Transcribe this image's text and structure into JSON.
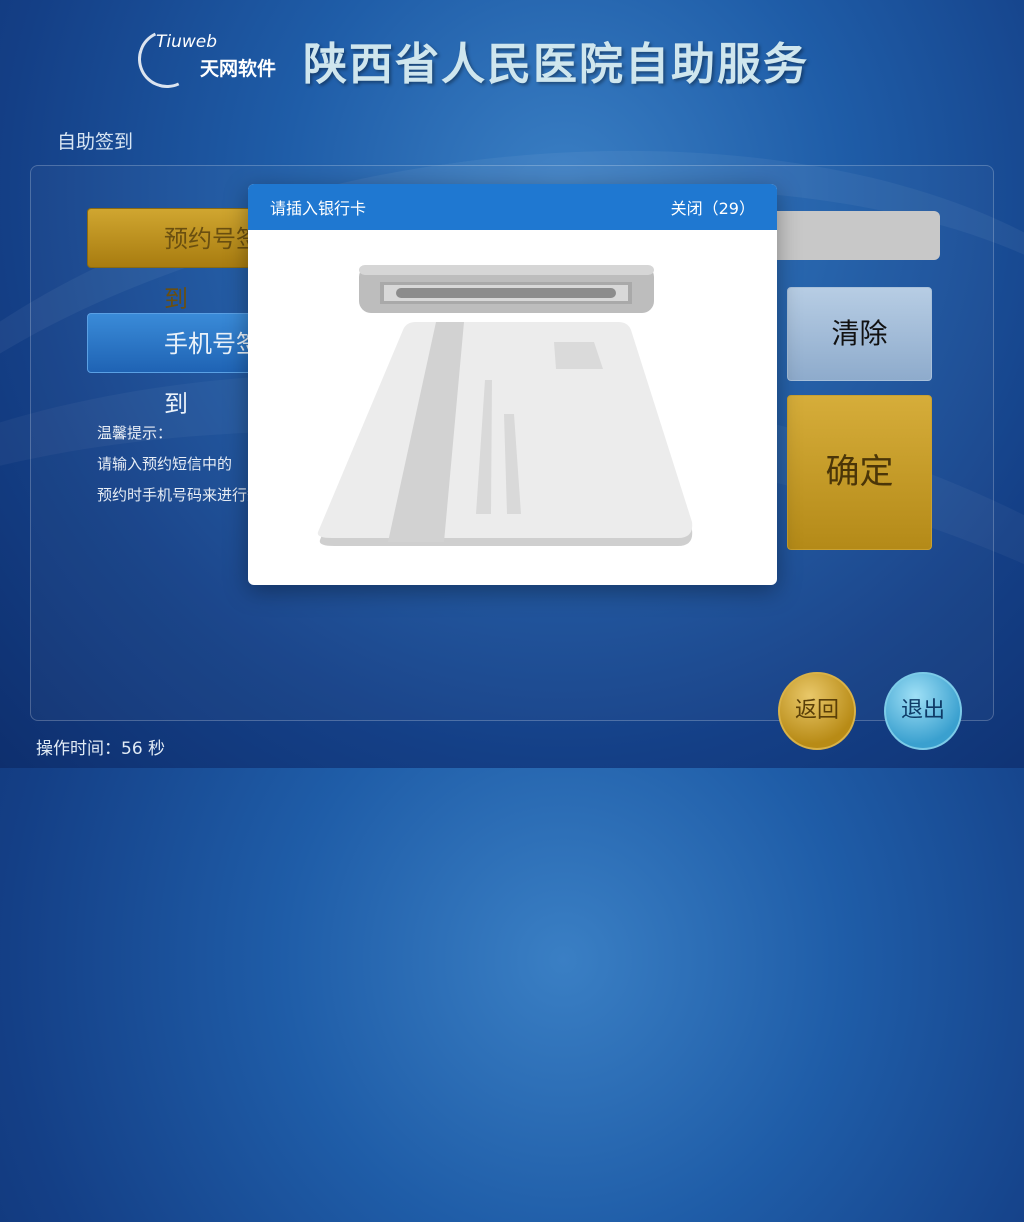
{
  "header": {
    "logo_en": "Tiuweb",
    "logo_cn": "天网软件",
    "title": "陕西省人民医院自助服务"
  },
  "breadcrumb": "自助签到",
  "tabs": {
    "appointment": "预约号签到",
    "phone": "手机号签到"
  },
  "tips": {
    "title": "温馨提示：",
    "line1": "请输入预约短信中的",
    "line2": "预约时手机号码来进行签到"
  },
  "buttons": {
    "clear": "清除",
    "confirm": "确定",
    "back": "返回",
    "exit": "退出"
  },
  "timer": "操作时间：56 秒",
  "modal": {
    "title": "请插入银行卡",
    "close": "关闭（29）"
  },
  "colors": {
    "modal_header": "#1f78d1",
    "confirm": "#c49a28",
    "clear": "#9fb9d6",
    "back": "#c9a032",
    "exit": "#4fb0dc"
  }
}
